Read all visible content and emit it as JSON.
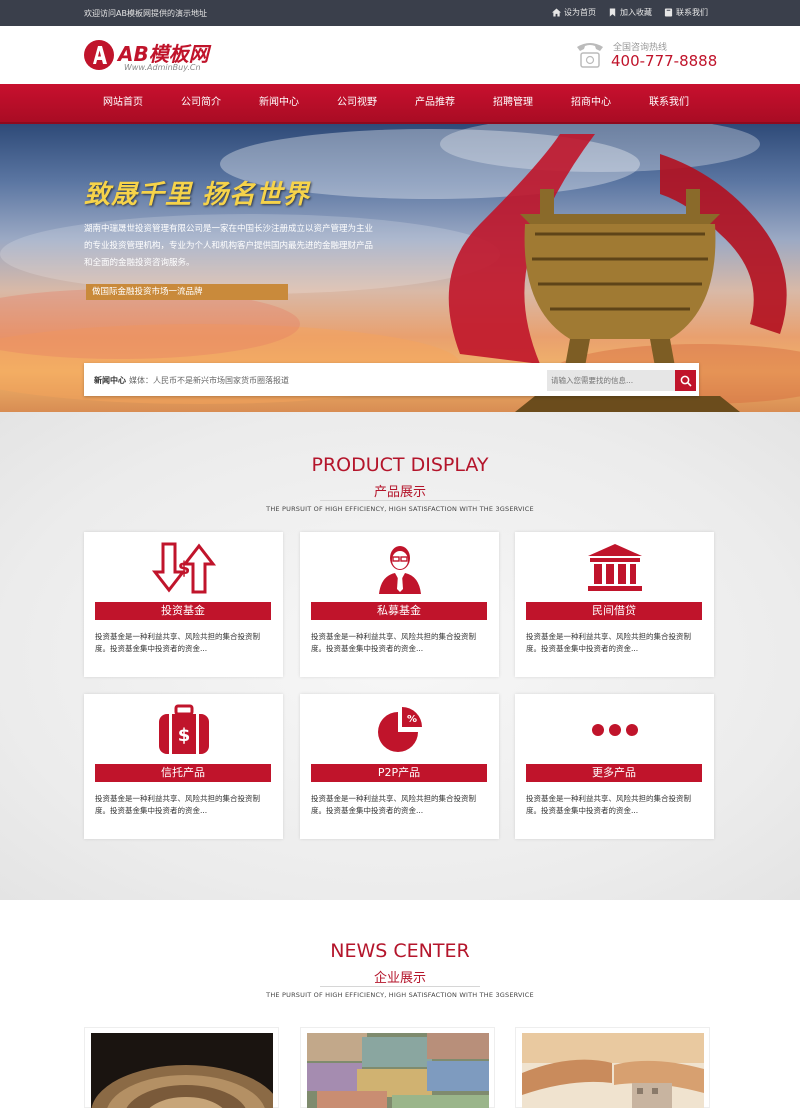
{
  "topbar": {
    "welcome": "欢迎访问AB模板网提供的演示地址",
    "links": [
      "设为首页",
      "加入收藏",
      "联系我们"
    ]
  },
  "header": {
    "logo_name": "AB模板网",
    "logo_url": "Www.AdminBuy.Cn",
    "hotline_label": "全国咨询热线",
    "hotline_number": "400-777-8888"
  },
  "nav": {
    "items": [
      "网站首页",
      "公司简介",
      "新闻中心",
      "公司视野",
      "产品推荐",
      "招聘管理",
      "招商中心",
      "联系我们"
    ]
  },
  "banner": {
    "slogan": "致晟千里  扬名世界",
    "intro": "湖南中瑞晟世投资管理有限公司是一家在中国长沙注册成立以资产管理为主业的专业投资管理机构，专业为个人和机构客户提供国内最先进的金融理财产品和全面的金融投资咨询服务。",
    "badge": "做国际金融投资市场一流品牌",
    "news_label": "新闻中心",
    "news_text": "媒体：人民币不是新兴市场国家货币圈落报道",
    "search_placeholder": "请输入您需要找的信息..."
  },
  "products": {
    "title_en": "PRODUCT DISPLAY",
    "title_cn": "产品展示",
    "subtitle": "THE PURSUIT OF HIGH EFFICIENCY, HIGH SATISFACTION WITH THE 3GSERVICE",
    "cards": [
      {
        "title": "投资基金",
        "icon": "exchange-dollar-icon",
        "desc": "投资基金是一种利益共享、风险共担的集合投资制度。投资基金集中投资者的资金..."
      },
      {
        "title": "私募基金",
        "icon": "businessman-icon",
        "desc": "投资基金是一种利益共享、风险共担的集合投资制度。投资基金集中投资者的资金..."
      },
      {
        "title": "民间借贷",
        "icon": "bank-icon",
        "desc": "投资基金是一种利益共享、风险共担的集合投资制度。投资基金集中投资者的资金..."
      },
      {
        "title": "信托产品",
        "icon": "money-bag-icon",
        "desc": "投资基金是一种利益共享、风险共担的集合投资制度。投资基金集中投资者的资金..."
      },
      {
        "title": "P2P产品",
        "icon": "pie-chart-icon",
        "desc": "投资基金是一种利益共享、风险共担的集合投资制度。投资基金集中投资者的资金..."
      },
      {
        "title": "更多产品",
        "icon": "more-dots-icon",
        "desc": "投资基金是一种利益共享、风险共担的集合投资制度。投资基金集中投资者的资金..."
      }
    ]
  },
  "news": {
    "title_en": "NEWS CENTER",
    "title_cn": "企业展示",
    "subtitle": "THE PURSUIT OF HIGH EFFICIENCY, HIGH SATISFACTION WITH THE 3GSERVICE"
  },
  "colors": {
    "brand_red": "#c0142b",
    "topbar": "#3a3f4b",
    "badge_gold": "#c98a3b"
  }
}
